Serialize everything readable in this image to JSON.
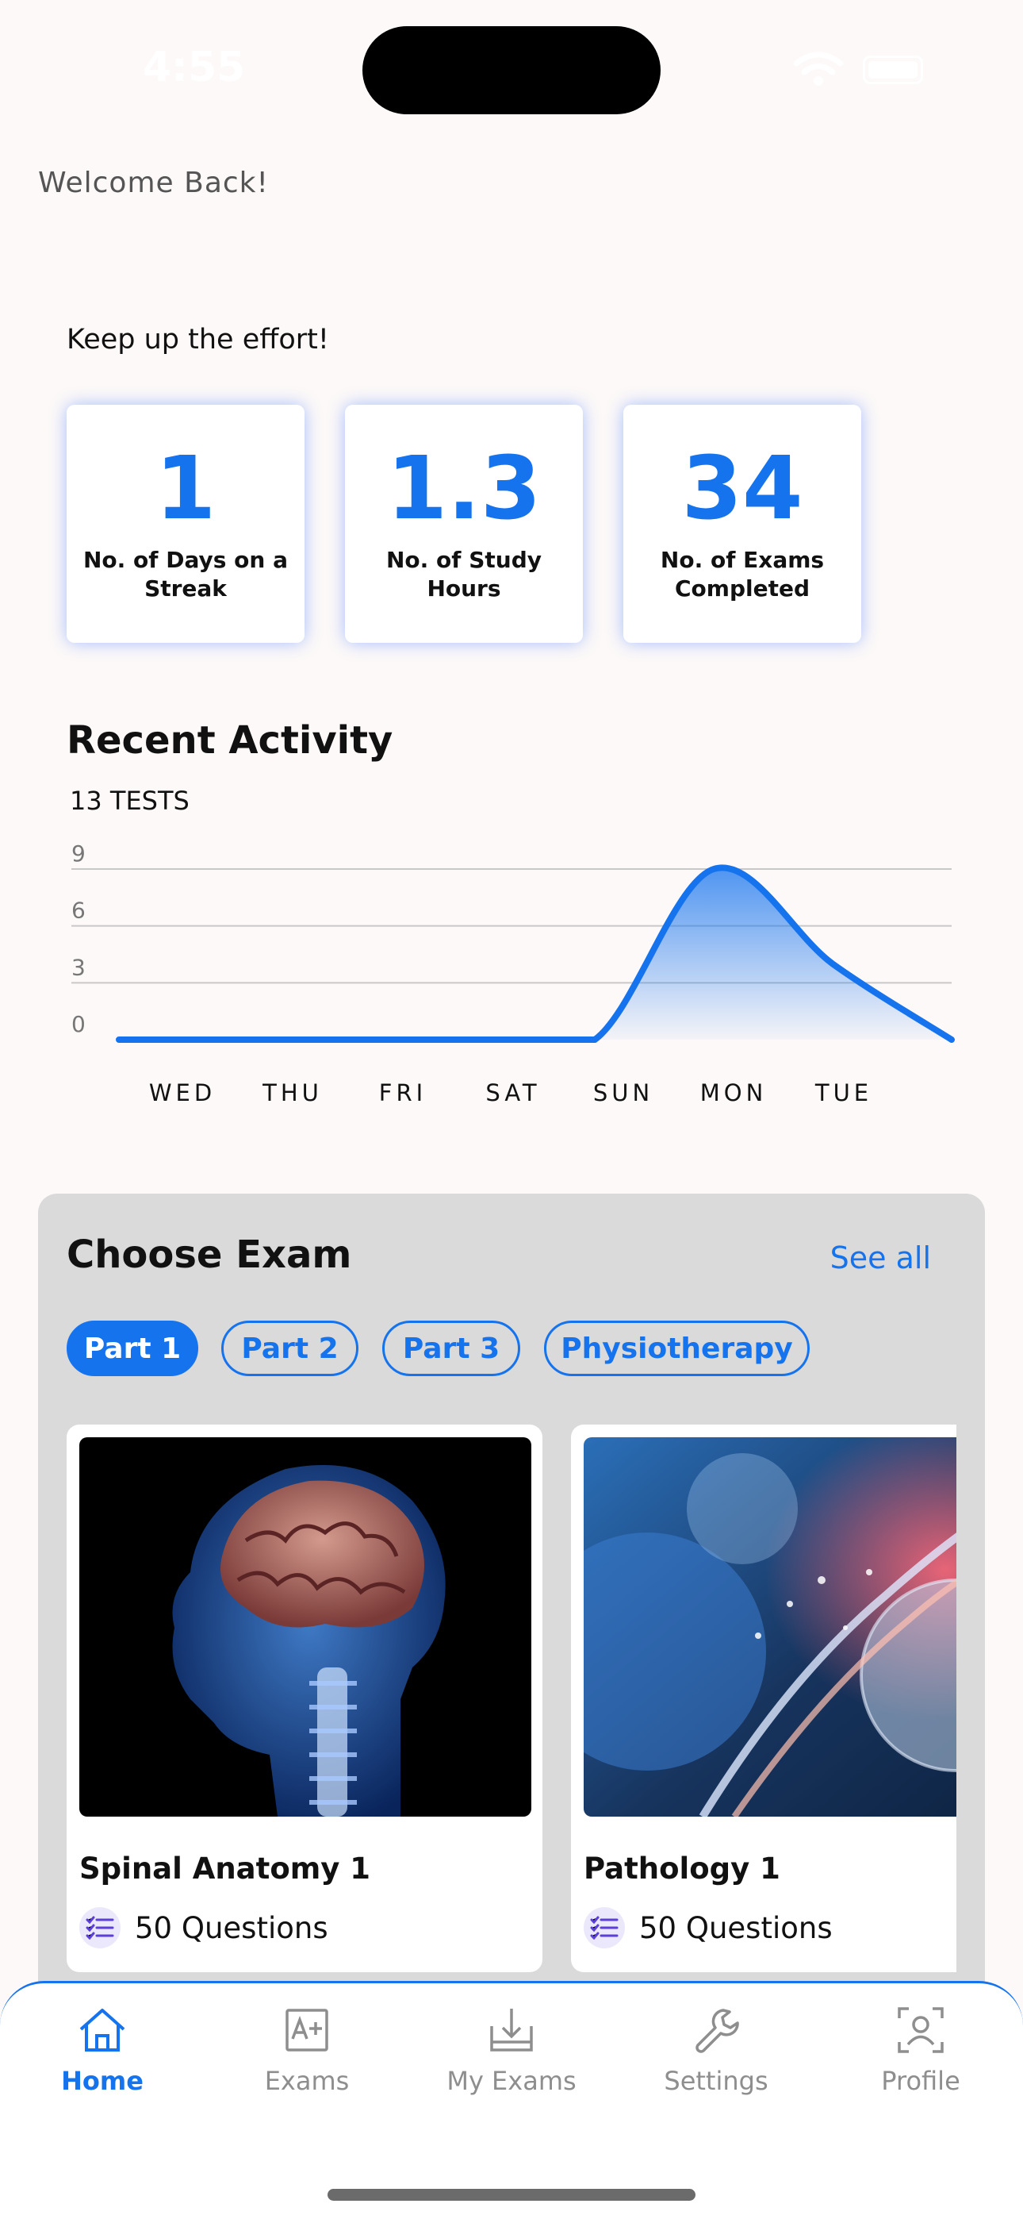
{
  "status": {
    "time": "4:55"
  },
  "header": {
    "welcome": "Welcome Back!",
    "motivation": "Keep up the effort!"
  },
  "stats": [
    {
      "value": "1",
      "label": "No. of Days on a Streak"
    },
    {
      "value": "1.3",
      "label": "No. of Study Hours"
    },
    {
      "value": "34",
      "label": "No. of Exams Completed"
    }
  ],
  "activity": {
    "title": "Recent Activity",
    "subtitle": "13 TESTS"
  },
  "chart_data": {
    "type": "area",
    "title": "Recent Activity",
    "subtitle": "13 TESTS",
    "categories": [
      "WED",
      "THU",
      "FRI",
      "SAT",
      "SUN",
      "MON",
      "TUE"
    ],
    "values": [
      0,
      0,
      0,
      0,
      0,
      9,
      4,
      0
    ],
    "y_ticks": [
      0,
      3,
      6,
      9
    ],
    "ylim": [
      0,
      9
    ],
    "grid": true,
    "color": "#1573ee"
  },
  "exam": {
    "title": "Choose Exam",
    "see_all": "See all",
    "chips": [
      "Part 1",
      "Part 2",
      "Part 3",
      "Physiotherapy"
    ],
    "active_chip": "Part 1",
    "cards": [
      {
        "name": "Spinal Anatomy 1",
        "questions": "50 Questions"
      },
      {
        "name": "Pathology 1",
        "questions": "50 Questions"
      }
    ]
  },
  "nav": {
    "items": [
      {
        "label": "Home",
        "icon": "home-icon"
      },
      {
        "label": "Exams",
        "icon": "grade-icon"
      },
      {
        "label": "My Exams",
        "icon": "download-icon"
      },
      {
        "label": "Settings",
        "icon": "wrench-icon"
      },
      {
        "label": "Profile",
        "icon": "profile-icon"
      }
    ],
    "active": "Home"
  },
  "colors": {
    "accent": "#1573ee",
    "background": "#fdf9f8",
    "panel": "#dadada"
  }
}
